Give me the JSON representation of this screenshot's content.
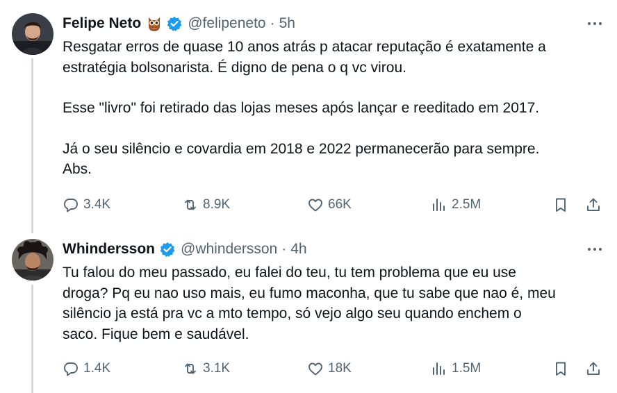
{
  "tweets": [
    {
      "name": "Felipe Neto",
      "handle": "@felipeneto",
      "time": "5h",
      "emoji_icon": "owl-emoji-icon",
      "lines": [
        "Resgatar erros de quase 10 anos atrás p atacar reputação é exatamente a",
        "estratégia bolsonarista. É digno de pena o q vc virou.",
        "",
        "Esse \"livro\" foi retirado das lojas meses após lançar e reeditado em 2017.",
        "",
        "Já o seu silêncio e covardia em 2018 e 2022 permanecerão para sempre.",
        "Abs."
      ],
      "replies": "3.4K",
      "retweets": "8.9K",
      "likes": "66K",
      "views": "2.5M"
    },
    {
      "name": "Whindersson",
      "handle": "@whindersson",
      "time": "4h",
      "lines": [
        "Tu falou do meu passado, eu falei do teu, tu tem problema que eu use",
        "droga? Pq eu nao uso mais, eu fumo maconha, que tu sabe que nao é, meu",
        "silêncio ja está pra vc a mto tempo, só vejo algo seu quando enchem o",
        "saco. Fique bem e saudável."
      ],
      "replies": "1.4K",
      "retweets": "3.1K",
      "likes": "18K",
      "views": "1.5M"
    }
  ],
  "separator": "·",
  "icons": [
    "verified-badge-icon",
    "more-icon",
    "reply-icon",
    "retweet-icon",
    "like-icon",
    "views-icon",
    "bookmark-icon",
    "share-icon"
  ],
  "colors": {
    "verified": "#1d9bf0",
    "secondary_text": "#536471",
    "thread_line": "#cfd9de"
  }
}
